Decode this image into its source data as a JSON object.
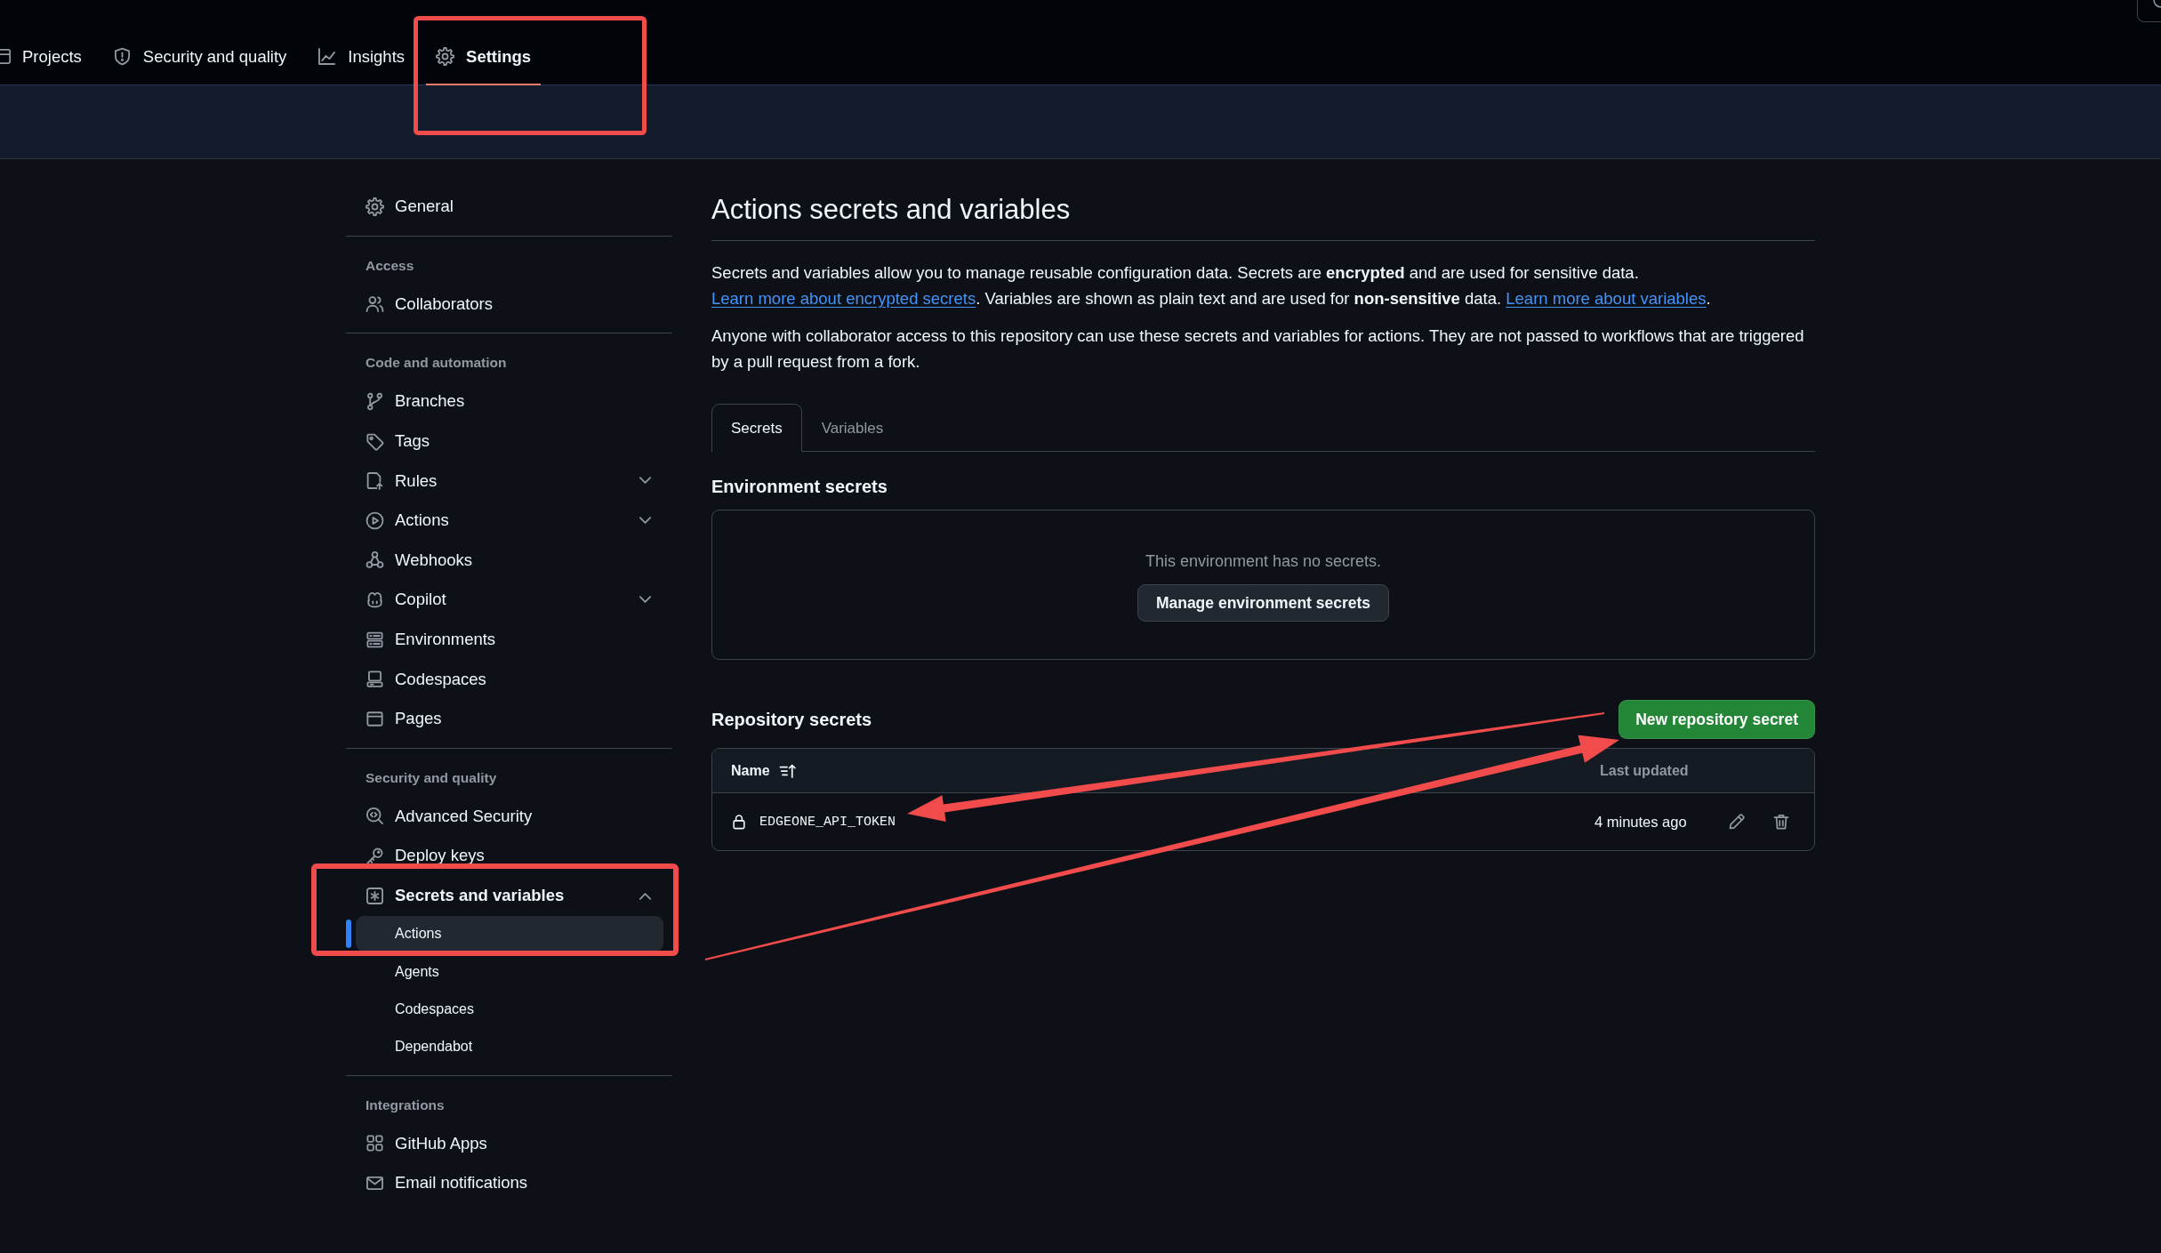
{
  "top_nav": {
    "tabs": [
      {
        "label": "Projects",
        "selected": false
      },
      {
        "label": "Security and quality",
        "selected": false
      },
      {
        "label": "Insights",
        "selected": false
      },
      {
        "label": "Settings",
        "selected": true
      }
    ]
  },
  "sidebar": {
    "groups": [
      {
        "items": [
          {
            "label": "General",
            "selected": false
          }
        ]
      },
      {
        "heading": "Access",
        "items": [
          {
            "label": "Collaborators",
            "selected": false
          }
        ]
      },
      {
        "heading": "Code and automation",
        "items": [
          {
            "label": "Branches",
            "selected": false
          },
          {
            "label": "Tags",
            "selected": false
          },
          {
            "label": "Rules",
            "selected": false,
            "expanded": false
          },
          {
            "label": "Actions",
            "selected": false,
            "expanded": false
          },
          {
            "label": "Webhooks",
            "selected": false
          },
          {
            "label": "Copilot",
            "selected": false,
            "expanded": false
          },
          {
            "label": "Environments",
            "selected": false
          },
          {
            "label": "Codespaces",
            "selected": false
          },
          {
            "label": "Pages",
            "selected": false
          }
        ]
      },
      {
        "heading": "Security and quality",
        "items": [
          {
            "label": "Advanced Security",
            "selected": false
          },
          {
            "label": "Deploy keys",
            "selected": false
          },
          {
            "label": "Secrets and variables",
            "selected": false,
            "expanded": true,
            "children": [
              {
                "label": "Actions",
                "selected": true
              },
              {
                "label": "Agents",
                "selected": false
              },
              {
                "label": "Codespaces",
                "selected": false
              },
              {
                "label": "Dependabot",
                "selected": false
              }
            ]
          }
        ]
      },
      {
        "heading": "Integrations",
        "items": [
          {
            "label": "GitHub Apps",
            "selected": false
          },
          {
            "label": "Email notifications",
            "selected": false
          }
        ]
      }
    ]
  },
  "main": {
    "title": "Actions secrets and variables",
    "intro": [
      {
        "kind": "text",
        "text": "Secrets and variables allow you to manage reusable configuration data. Secrets are **encrypted** and are used for sensitive data. "
      },
      {
        "kind": "link",
        "text": "Learn more about encrypted secrets"
      },
      {
        "kind": "text",
        "text": ". Variables are shown as plain text and are used for **non-sensitive** data. "
      },
      {
        "kind": "link",
        "text": "Learn more about variables"
      },
      {
        "kind": "text",
        "text": "."
      }
    ],
    "note": "Anyone with collaborator access to this repository can use these secrets and variables for actions. They are not passed to workflows that are triggered by a pull request from a fork.",
    "tabs": [
      {
        "label": "Secrets",
        "selected": true
      },
      {
        "label": "Variables",
        "selected": false
      }
    ],
    "environment_secrets": {
      "heading": "Environment secrets",
      "empty_message": "This environment has no secrets.",
      "button": "Manage environment secrets"
    },
    "repository_secrets": {
      "heading": "Repository secrets",
      "button": "New repository secret",
      "table": {
        "columns": [
          "Name",
          "Last updated"
        ],
        "rows": [
          {
            "name": "EDGEONE_API_TOKEN",
            "last_updated": "4 minutes ago"
          }
        ]
      }
    }
  }
}
